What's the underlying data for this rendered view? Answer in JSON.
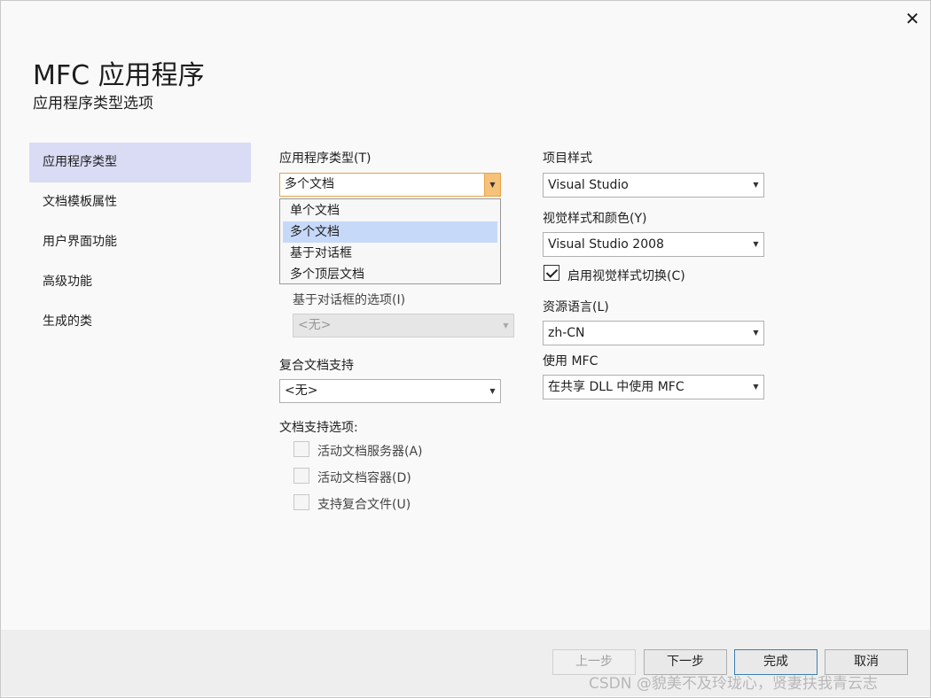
{
  "dialog": {
    "close_glyph": "✕",
    "title": "MFC 应用程序",
    "subtitle": "应用程序类型选项"
  },
  "nav": {
    "items": [
      {
        "label": "应用程序类型",
        "active": true
      },
      {
        "label": "文档模板属性",
        "active": false
      },
      {
        "label": "用户界面功能",
        "active": false
      },
      {
        "label": "高级功能",
        "active": false
      },
      {
        "label": "生成的类",
        "active": false
      }
    ]
  },
  "app_type": {
    "label": "应用程序类型(T)",
    "value": "多个文档",
    "options": [
      "单个文档",
      "多个文档",
      "基于对话框",
      "多个顶层文档"
    ],
    "selected_index": 1
  },
  "dialog_options": {
    "label": "基于对话框的选项(I)",
    "value": "<无>"
  },
  "compound_doc": {
    "label": "复合文档支持",
    "value": "<无>"
  },
  "doc_support": {
    "label": "文档支持选项:",
    "options": [
      "活动文档服务器(A)",
      "活动文档容器(D)",
      "支持复合文件(U)"
    ]
  },
  "project_style": {
    "label": "项目样式",
    "value": "Visual Studio"
  },
  "visual_style": {
    "label": "视觉样式和颜色(Y)",
    "value": "Visual Studio 2008"
  },
  "style_switch": {
    "label": "启用视觉样式切换(C)",
    "checked": true
  },
  "resource_lang": {
    "label": "资源语言(L)",
    "value": "zh-CN"
  },
  "use_mfc": {
    "label": "使用 MFC",
    "value": "在共享 DLL 中使用 MFC"
  },
  "buttons": {
    "prev": "上一步",
    "next": "下一步",
    "finish": "完成",
    "cancel": "取消"
  },
  "watermark": "CSDN @貌美不及玲珑心，贤妻扶我青云志",
  "colors": {
    "nav_active_bg": "#dadcf5",
    "dropdown_selected_bg": "#c7d9f9",
    "focused_arrow_bg": "#f6c27a"
  }
}
